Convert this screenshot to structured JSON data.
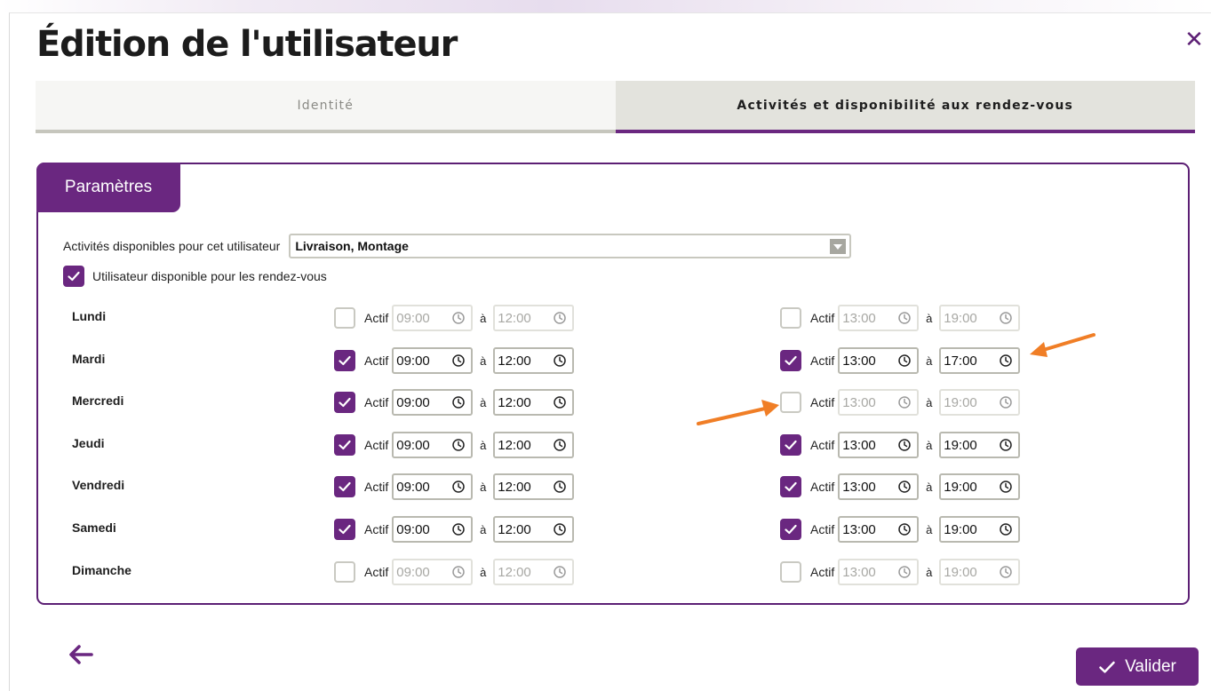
{
  "dialog": {
    "title": "Édition de l'utilisateur",
    "close_icon": "close-icon"
  },
  "tabs": [
    {
      "label": "Identité",
      "active": false
    },
    {
      "label": "Activités et disponibilité aux rendez-vous",
      "active": true
    }
  ],
  "panel": {
    "header": "Paramètres",
    "activities_label": "Activités disponibles pour cet utilisateur",
    "activities_value": "Livraison, Montage",
    "available_label": "Utilisateur disponible pour les rendez-vous",
    "available_checked": true
  },
  "labels": {
    "actif": "Actif",
    "to": "à"
  },
  "schedule": [
    {
      "day": "Lundi",
      "morning": {
        "active": false,
        "from": "09:00",
        "to": "12:00"
      },
      "afternoon": {
        "active": false,
        "from": "13:00",
        "to": "19:00"
      }
    },
    {
      "day": "Mardi",
      "morning": {
        "active": true,
        "from": "09:00",
        "to": "12:00"
      },
      "afternoon": {
        "active": true,
        "from": "13:00",
        "to": "17:00"
      }
    },
    {
      "day": "Mercredi",
      "morning": {
        "active": true,
        "from": "09:00",
        "to": "12:00"
      },
      "afternoon": {
        "active": false,
        "from": "13:00",
        "to": "19:00"
      }
    },
    {
      "day": "Jeudi",
      "morning": {
        "active": true,
        "from": "09:00",
        "to": "12:00"
      },
      "afternoon": {
        "active": true,
        "from": "13:00",
        "to": "19:00"
      }
    },
    {
      "day": "Vendredi",
      "morning": {
        "active": true,
        "from": "09:00",
        "to": "12:00"
      },
      "afternoon": {
        "active": true,
        "from": "13:00",
        "to": "19:00"
      }
    },
    {
      "day": "Samedi",
      "morning": {
        "active": true,
        "from": "09:00",
        "to": "12:00"
      },
      "afternoon": {
        "active": true,
        "from": "13:00",
        "to": "19:00"
      }
    },
    {
      "day": "Dimanche",
      "morning": {
        "active": false,
        "from": "09:00",
        "to": "12:00"
      },
      "afternoon": {
        "active": false,
        "from": "13:00",
        "to": "19:00"
      }
    }
  ],
  "footer": {
    "back_icon": "arrow-left-icon",
    "validate_label": "Valider"
  },
  "colors": {
    "brand": "#6a2780",
    "annotation_arrow": "#f07e26",
    "tab_active_bg": "#e3e3dd",
    "tab_inactive_bg": "#f6f6f4"
  }
}
